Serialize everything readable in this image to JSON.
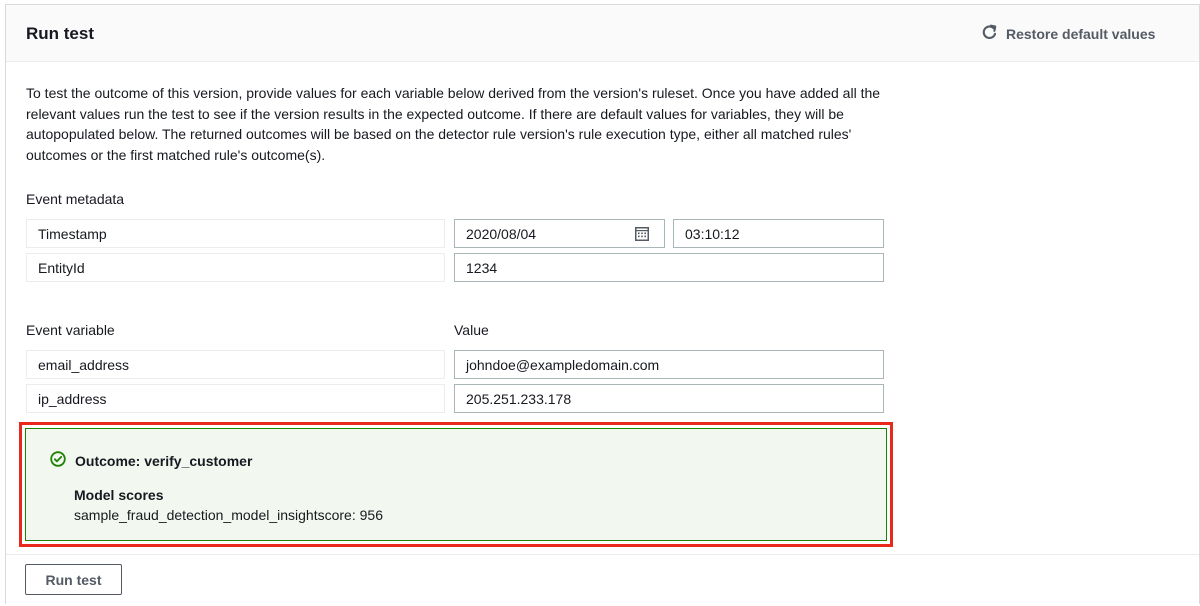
{
  "header": {
    "title": "Run test",
    "restore_label": "Restore default values"
  },
  "description": "To test the outcome of this version, provide values for each variable below derived from the version's ruleset. Once you have added all the relevant values run the test to see if the version results in the expected outcome. If there are default values for variables, they will be autopopulated below. The returned outcomes will be based on the detector rule version's rule execution type, either all matched rules' outcomes or the first matched rule's outcome(s).",
  "event_metadata": {
    "label": "Event metadata",
    "timestamp": {
      "name": "Timestamp",
      "date": "2020/08/04",
      "time": "03:10:12"
    },
    "entity": {
      "name": "EntityId",
      "value": "1234"
    }
  },
  "event_variables": {
    "variable_header": "Event variable",
    "value_header": "Value",
    "rows": [
      {
        "name": "email_address",
        "value": "johndoe@exampledomain.com"
      },
      {
        "name": "ip_address",
        "value": "205.251.233.178"
      }
    ]
  },
  "outcome": {
    "title": "Outcome: verify_customer",
    "scores_title": "Model scores",
    "score_line": "sample_fraud_detection_model_insightscore: 956",
    "success_color": "#1d8102",
    "highlight_color": "#e8291c"
  },
  "footer": {
    "run_label": "Run test"
  },
  "icons": {
    "restore": "refresh-icon",
    "calendar": "calendar-icon",
    "outcome": "check-circle-icon"
  }
}
